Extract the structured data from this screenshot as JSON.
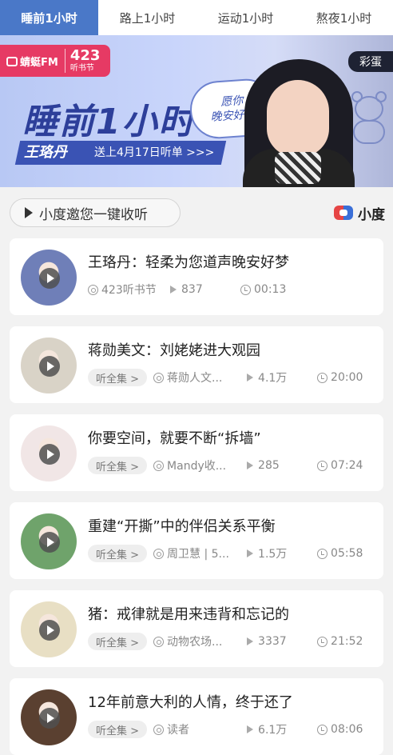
{
  "tabs": [
    {
      "label": "睡前1小时",
      "active": true
    },
    {
      "label": "路上1小时",
      "active": false
    },
    {
      "label": "运动1小时",
      "active": false
    },
    {
      "label": "熬夜1小时",
      "active": false
    }
  ],
  "banner": {
    "fm_logo": "蜻蜓FM",
    "fm_num": "423",
    "fm_sub": "听书节",
    "title": "睡前1小时",
    "name": "王珞丹",
    "subtitle": "送上4月17日听单 >>>",
    "bubble": "愿你\n晚安好梦",
    "egg": "彩蛋"
  },
  "invite": {
    "label": "小度邀您一键收听",
    "brand": "小度"
  },
  "items": [
    {
      "title": "王珞丹：轻柔为您道声晚安好梦",
      "listen_all": "",
      "author": "423听书节",
      "plays": "837",
      "duration": "00:13",
      "thumb_color": "#6f7fb8"
    },
    {
      "title": "蒋勋美文：刘姥姥进大观园",
      "listen_all": "听全集 >",
      "author": "蒋勋人文...",
      "plays": "4.1万",
      "duration": "20:00",
      "thumb_color": "#d9d3c7"
    },
    {
      "title": "你要空间，就要不断“拆墙”",
      "listen_all": "听全集 >",
      "author": "Mandy收...",
      "plays": "285",
      "duration": "07:24",
      "thumb_color": "#f1e6e6"
    },
    {
      "title": "重建“开撕”中的伴侣关系平衡",
      "listen_all": "听全集 >",
      "author": "周卫慧 | 5...",
      "plays": "1.5万",
      "duration": "05:58",
      "thumb_color": "#6fa36b"
    },
    {
      "title": "猪：戒律就是用来违背和忘记的",
      "listen_all": "听全集 >",
      "author": "动物农场...",
      "plays": "3337",
      "duration": "21:52",
      "thumb_color": "#e8dfc4"
    },
    {
      "title": "12年前意大利的人情，终于还了",
      "listen_all": "听全集 >",
      "author": "读者",
      "plays": "6.1万",
      "duration": "08:06",
      "thumb_color": "#5a4030"
    }
  ]
}
